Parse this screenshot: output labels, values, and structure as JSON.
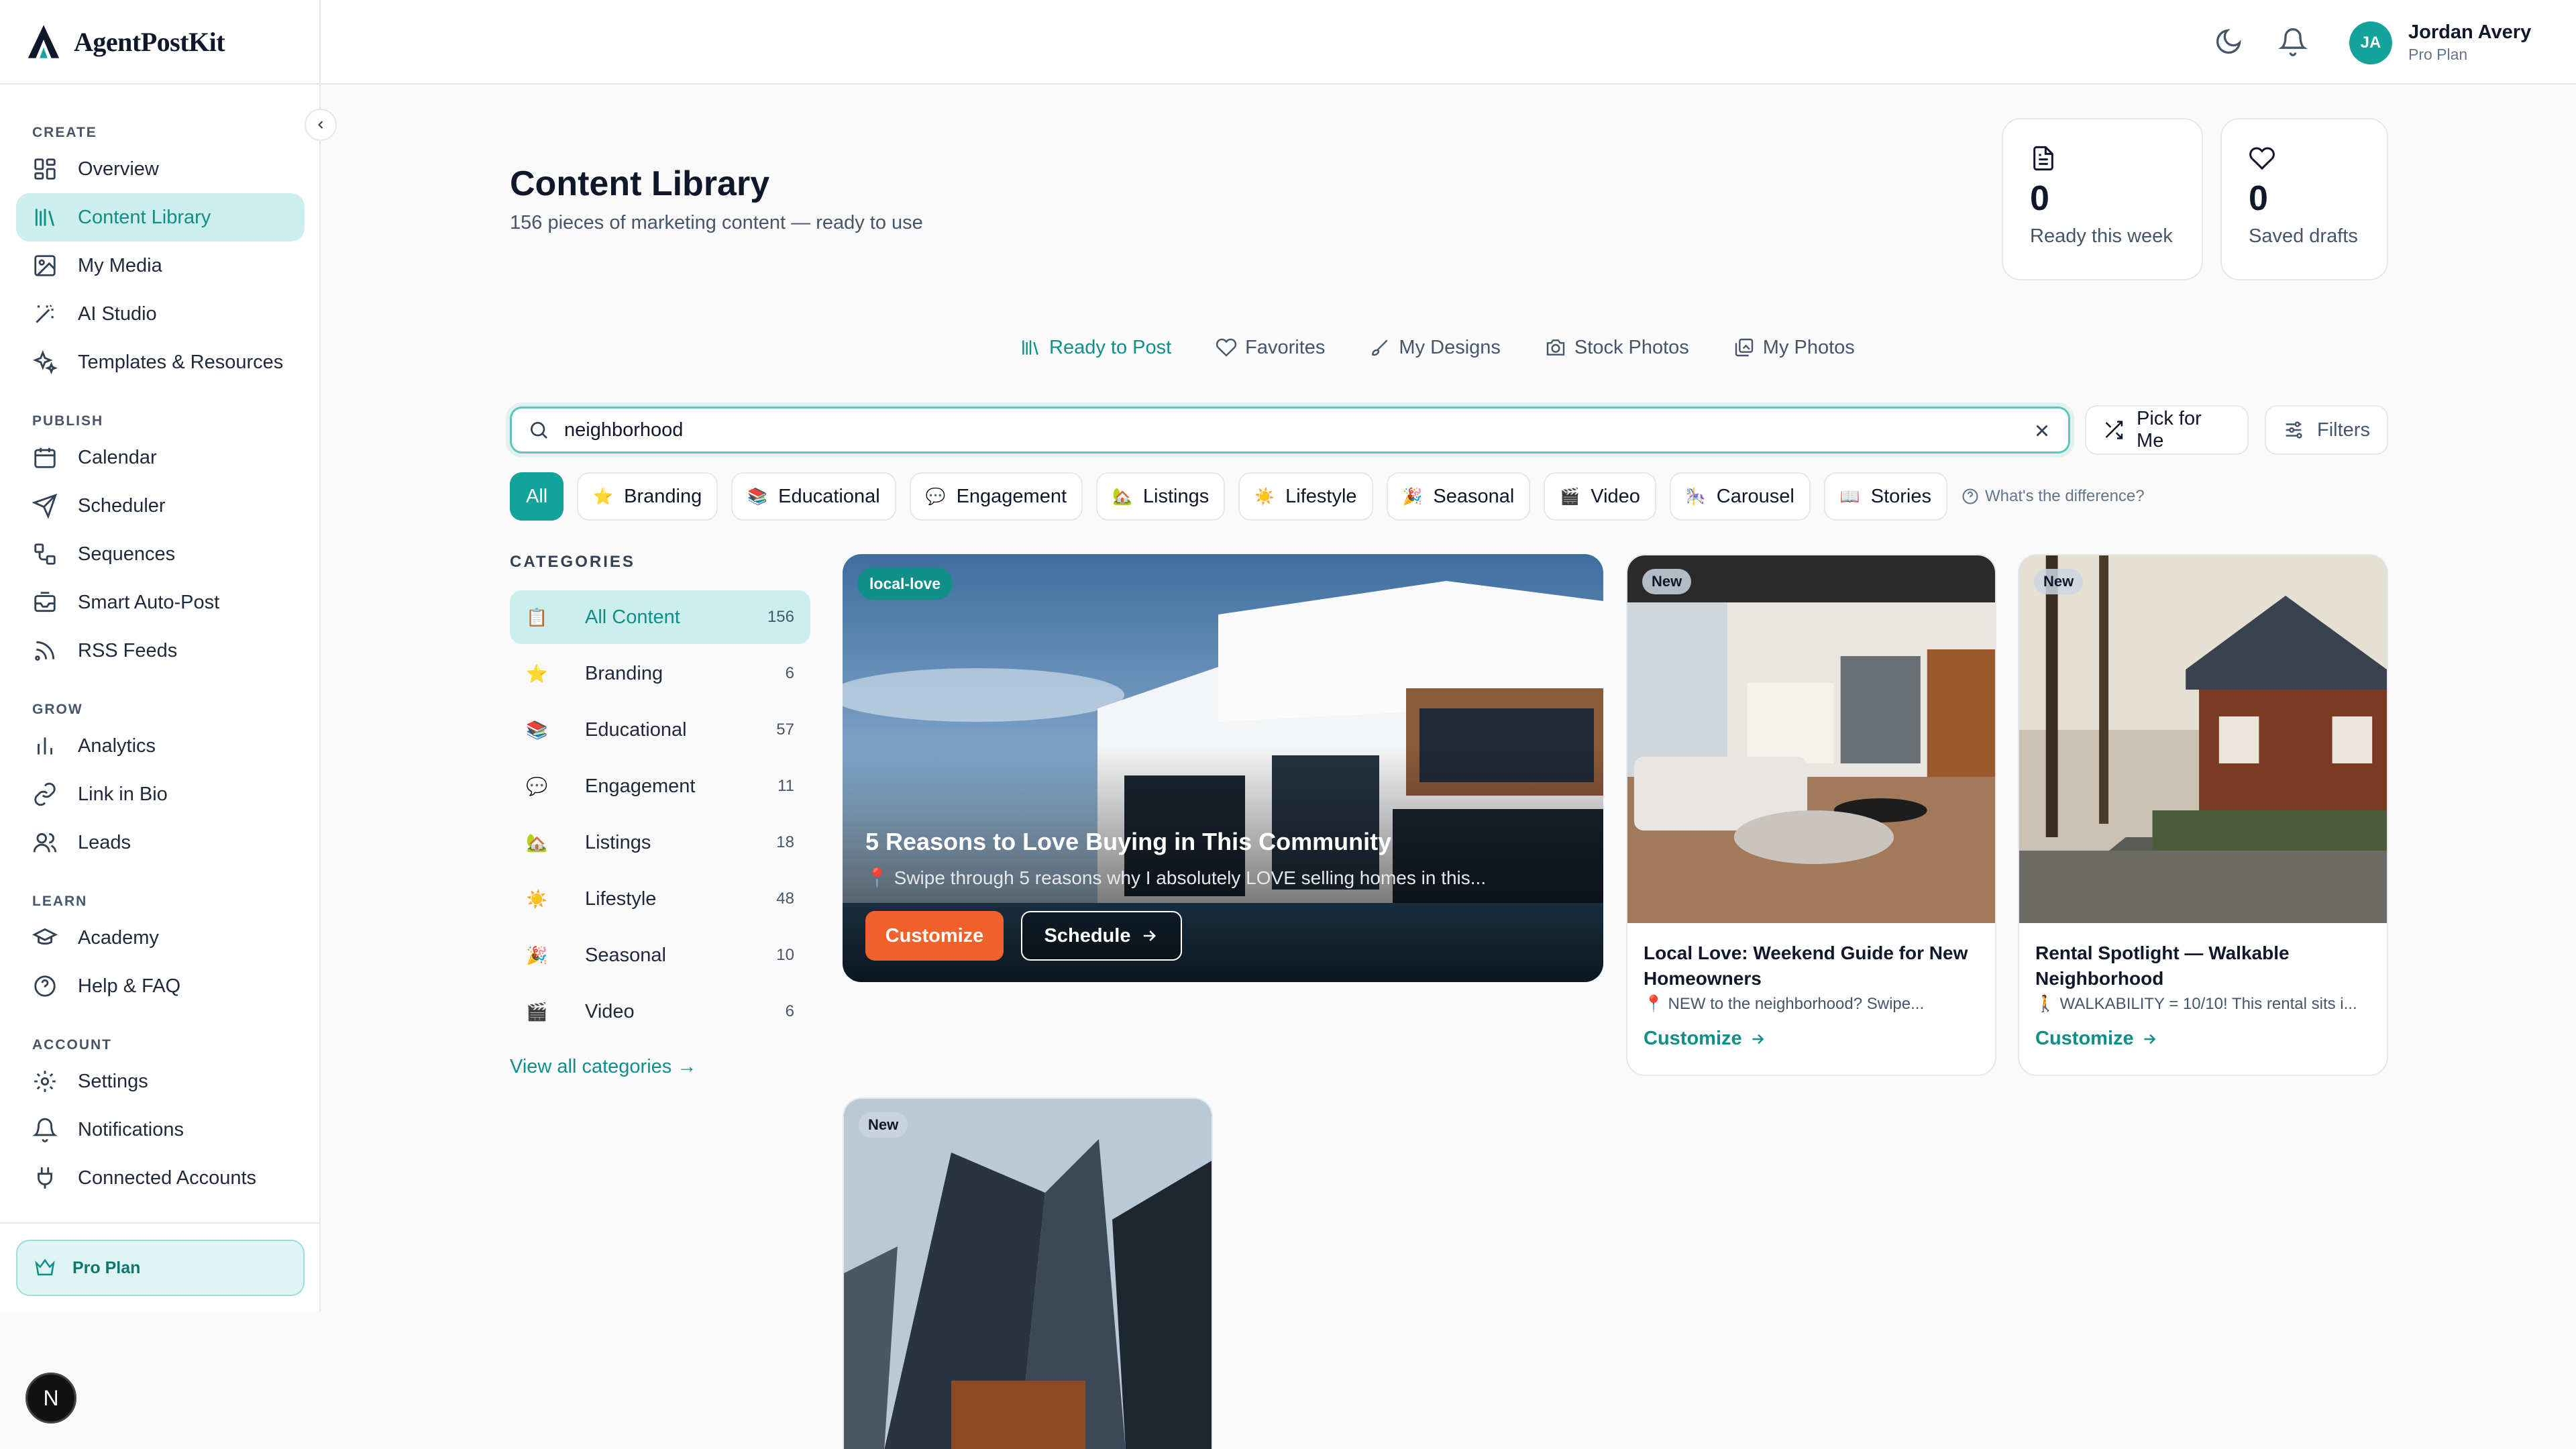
{
  "brand": {
    "name": "AgentPostKit"
  },
  "sidebar": {
    "sections": [
      {
        "title": "CREATE",
        "items": [
          {
            "label": "Overview",
            "icon": "grid-icon"
          },
          {
            "label": "Content Library",
            "icon": "library-icon",
            "active": true
          },
          {
            "label": "My Media",
            "icon": "image-icon"
          },
          {
            "label": "AI Studio",
            "icon": "wand-icon"
          },
          {
            "label": "Templates & Resources",
            "icon": "sparkles-icon"
          }
        ]
      },
      {
        "title": "PUBLISH",
        "items": [
          {
            "label": "Calendar",
            "icon": "calendar-icon"
          },
          {
            "label": "Scheduler",
            "icon": "send-icon"
          },
          {
            "label": "Sequences",
            "icon": "workflow-icon"
          },
          {
            "label": "Smart Auto-Post",
            "icon": "inbox-icon"
          },
          {
            "label": "RSS Feeds",
            "icon": "rss-icon"
          }
        ]
      },
      {
        "title": "GROW",
        "items": [
          {
            "label": "Analytics",
            "icon": "bar-chart-icon"
          },
          {
            "label": "Link in Bio",
            "icon": "link-icon"
          },
          {
            "label": "Leads",
            "icon": "users-icon"
          }
        ]
      },
      {
        "title": "LEARN",
        "items": [
          {
            "label": "Academy",
            "icon": "graduation-cap-icon"
          },
          {
            "label": "Help & FAQ",
            "icon": "help-circle-icon"
          }
        ]
      },
      {
        "title": "ACCOUNT",
        "items": [
          {
            "label": "Settings",
            "icon": "gear-icon"
          },
          {
            "label": "Notifications",
            "icon": "bell-icon"
          },
          {
            "label": "Connected Accounts",
            "icon": "plug-icon"
          }
        ]
      }
    ],
    "plan_label": "Pro Plan",
    "n_badge": "N"
  },
  "topbar": {
    "user": {
      "initials": "JA",
      "name": "Jordan Avery",
      "plan": "Pro Plan"
    }
  },
  "header": {
    "title": "Content Library",
    "subtitle": "156 pieces of marketing content — ready to use",
    "stats": [
      {
        "value": "0",
        "label": "Ready this week",
        "icon": "document-icon"
      },
      {
        "value": "0",
        "label": "Saved drafts",
        "icon": "heart-icon"
      }
    ]
  },
  "tabs": [
    {
      "label": "Ready to Post",
      "icon": "library-icon",
      "active": true
    },
    {
      "label": "Favorites",
      "icon": "heart-icon"
    },
    {
      "label": "My Designs",
      "icon": "brush-icon"
    },
    {
      "label": "Stock Photos",
      "icon": "camera-icon"
    },
    {
      "label": "My Photos",
      "icon": "images-icon"
    }
  ],
  "search": {
    "value": "neighborhood",
    "pick_label": "Pick for Me",
    "filters_label": "Filters"
  },
  "chips": [
    {
      "label": "All",
      "emoji": "",
      "active": true
    },
    {
      "label": "Branding",
      "emoji": "⭐"
    },
    {
      "label": "Educational",
      "emoji": "📚"
    },
    {
      "label": "Engagement",
      "emoji": "💬"
    },
    {
      "label": "Listings",
      "emoji": "🏡"
    },
    {
      "label": "Lifestyle",
      "emoji": "☀️"
    },
    {
      "label": "Seasonal",
      "emoji": "🎉"
    },
    {
      "label": "Video",
      "emoji": "🎬"
    },
    {
      "label": "Carousel",
      "emoji": "🎠"
    },
    {
      "label": "Stories",
      "emoji": "📖"
    }
  ],
  "chip_help": "What's the difference?",
  "categories": {
    "title": "CATEGORIES",
    "items": [
      {
        "label": "All Content",
        "count": "156",
        "emoji": "📋",
        "active": true
      },
      {
        "label": "Branding",
        "count": "6",
        "emoji": "⭐"
      },
      {
        "label": "Educational",
        "count": "57",
        "emoji": "📚"
      },
      {
        "label": "Engagement",
        "count": "11",
        "emoji": "💬"
      },
      {
        "label": "Listings",
        "count": "18",
        "emoji": "🏡"
      },
      {
        "label": "Lifestyle",
        "count": "48",
        "emoji": "☀️"
      },
      {
        "label": "Seasonal",
        "count": "10",
        "emoji": "🎉"
      },
      {
        "label": "Video",
        "count": "6",
        "emoji": "🎬"
      }
    ],
    "view_all": "View all categories →"
  },
  "featured": {
    "tag": "local-love",
    "title": "5 Reasons to Love Buying in This Community",
    "desc": "📍 Swipe through 5 reasons why I absolutely LOVE selling homes in this...",
    "customize": "Customize",
    "schedule": "Schedule"
  },
  "cards": [
    {
      "tag": "New",
      "title": "Local Love: Weekend Guide for New Homeowners",
      "desc": "📍 NEW to the neighborhood? Swipe...",
      "cta": "Customize"
    },
    {
      "tag": "New",
      "title": "Rental Spotlight — Walkable Neighborhood",
      "desc": "🚶 WALKABILITY = 10/10! This rental sits i...",
      "cta": "Customize"
    },
    {
      "tag": "New"
    }
  ]
}
